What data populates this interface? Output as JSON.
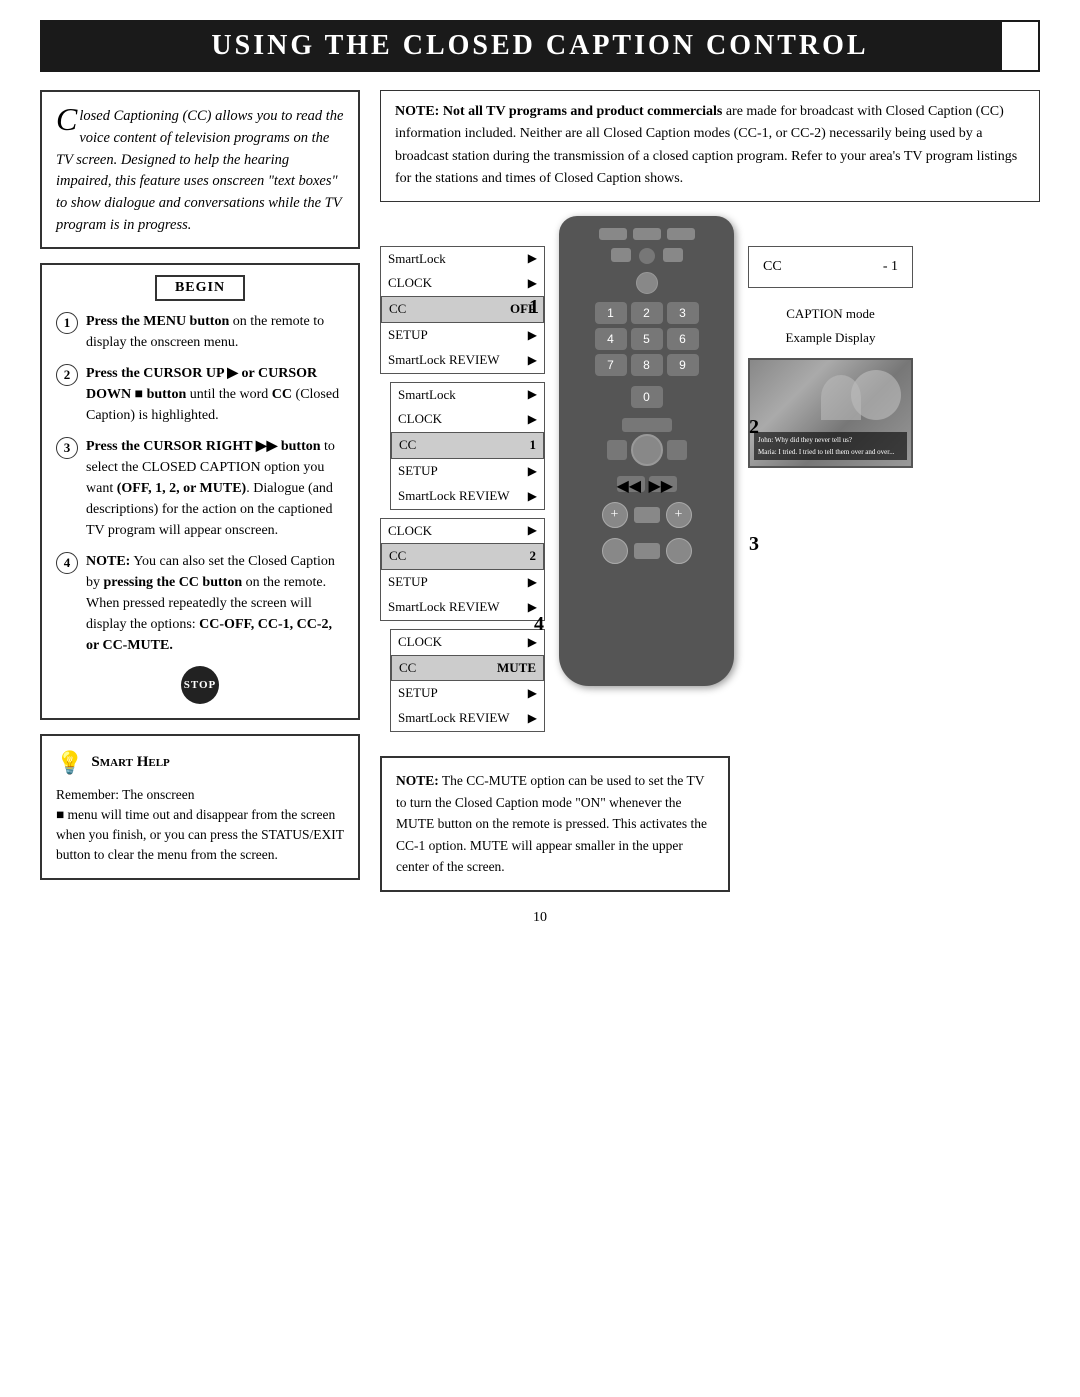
{
  "header": {
    "title": "Using the Closed Caption Control"
  },
  "intro": {
    "text": "losed Captioning (CC) allows you to read the voice content of television programs on the TV screen. Designed to help the hearing impaired, this feature uses onscreen \"text boxes\" to show dialogue and conversations while the TV program is in progress."
  },
  "begin_label": "BEGIN",
  "steps": [
    {
      "num": "1",
      "text": "Press the MENU button on the remote to display the onscreen menu."
    },
    {
      "num": "2",
      "text": "Press the CURSOR UP ▶ or CURSOR DOWN ■ button until the word CC (Closed Caption) is highlighted."
    },
    {
      "num": "3",
      "text": "Press the CURSOR RIGHT ▶▶ button to select the CLOSED CAPTION option you want (OFF, 1, 2, or MUTE). Dialogue (and descriptions) for the action on the captioned TV program will appear onscreen."
    },
    {
      "num": "4",
      "text": "NOTE: You can also set the Closed Caption by pressing the CC button on the remote. When pressed repeatedly the screen will display the options: CC-OFF, CC-1, CC-2, or CC-MUTE."
    }
  ],
  "stop_label": "STOP",
  "smart_help": {
    "title": "Smart Help",
    "text": "Remember: The onscreen menu will time out and disappear from the screen when you finish, or you can press the STATUS/EXIT button to clear the menu from the screen."
  },
  "note_top": {
    "bold_text": "NOTE: Not all TV programs and product commercials",
    "text": " are made for broadcast with Closed Caption (CC) information included. Neither are all Closed Caption modes (CC-1, or CC-2) necessarily being used by a broadcast station during the transmission of a closed caption program. Refer to your area's TV program listings for the stations and times of Closed Caption shows."
  },
  "menu_panels": [
    {
      "rows": [
        {
          "label": "SmartLock",
          "value": "▶"
        },
        {
          "label": "CLOCK",
          "value": "▶"
        },
        {
          "label": "CC",
          "value": "OFF",
          "highlighted": true
        },
        {
          "label": "SETUP",
          "value": "▶"
        },
        {
          "label": "SmartLock REVIEW",
          "value": "▶"
        }
      ]
    },
    {
      "rows": [
        {
          "label": "SmartLock",
          "value": "▶"
        },
        {
          "label": "CLOCK",
          "value": "▶"
        },
        {
          "label": "CC",
          "value": "1",
          "highlighted": true
        },
        {
          "label": "SETUP",
          "value": "▶"
        },
        {
          "label": "SmartLock REVIEW",
          "value": "▶"
        }
      ]
    },
    {
      "rows": [
        {
          "label": "CLOCK",
          "value": "▶"
        },
        {
          "label": "CC",
          "value": "2",
          "highlighted": true
        },
        {
          "label": "SETUP",
          "value": "▶"
        },
        {
          "label": "SmartLock REVIEW",
          "value": "▶"
        }
      ]
    },
    {
      "rows": [
        {
          "label": "CLOCK",
          "value": "▶"
        },
        {
          "label": "CC",
          "value": "MUTE",
          "highlighted": true
        },
        {
          "label": "SETUP",
          "value": "▶"
        },
        {
          "label": "SmartLock REVIEW",
          "value": "▶"
        }
      ]
    }
  ],
  "remote": {
    "numbers": [
      "1",
      "2",
      "3",
      "4",
      "5",
      "6",
      "7",
      "8",
      "9",
      "",
      "0",
      ""
    ]
  },
  "caption_panel_4": {
    "text": "CC - 1"
  },
  "caption_mode_label": "CAPTION mode",
  "example_display_label": "Example Display",
  "note_bottom": {
    "bold_text": "NOTE:",
    "text": " The CC-MUTE option can be used to set the TV to turn the Closed Caption mode \"ON\" whenever the MUTE button on the remote is pressed. This activates the CC-1 option. MUTE will appear smaller in the upper center of the screen."
  },
  "caption_text_overlay": "John: Why did they never tell us? Maria: I tried. I tried to tell them over and over.",
  "page_number": "10",
  "step_overlays": {
    "s1": "1",
    "s2": "2",
    "s3": "3",
    "s4": "4"
  }
}
